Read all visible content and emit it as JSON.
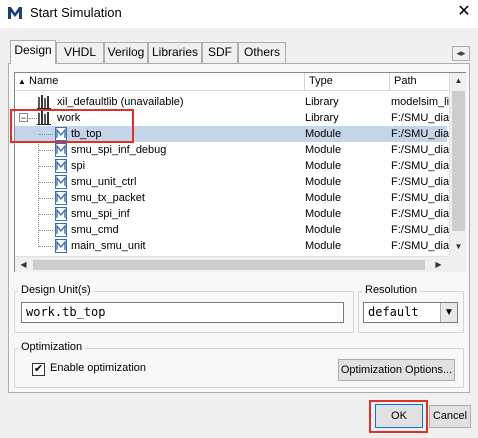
{
  "window": {
    "title": "Start Simulation",
    "close_glyph": "✕",
    "icon": "modelsim-logo-icon"
  },
  "tabs": [
    "Design",
    "VHDL",
    "Verilog",
    "Libraries",
    "SDF",
    "Others"
  ],
  "active_tab": "Design",
  "tab_scroll_glyph": "◂▸",
  "tree": {
    "columns": [
      "Name",
      "Type",
      "Path"
    ],
    "rows": [
      {
        "name": "xil_defaultlib  (unavailable)",
        "type": "Library",
        "path": "modelsim_lil",
        "kind": "library",
        "expander": "+"
      },
      {
        "name": "work",
        "type": "Library",
        "path": "F:/SMU_dia",
        "kind": "library",
        "expander": "−"
      },
      {
        "name": "tb_top",
        "type": "Module",
        "path": "F:/SMU_dia",
        "kind": "module",
        "selected": true
      },
      {
        "name": "smu_spi_inf_debug",
        "type": "Module",
        "path": "F:/SMU_dia",
        "kind": "module"
      },
      {
        "name": "spi",
        "type": "Module",
        "path": "F:/SMU_dia",
        "kind": "module"
      },
      {
        "name": "smu_unit_ctrl",
        "type": "Module",
        "path": "F:/SMU_dia",
        "kind": "module"
      },
      {
        "name": "smu_tx_packet",
        "type": "Module",
        "path": "F:/SMU_dia",
        "kind": "module"
      },
      {
        "name": "smu_spi_inf",
        "type": "Module",
        "path": "F:/SMU_dia",
        "kind": "module"
      },
      {
        "name": "smu_cmd",
        "type": "Module",
        "path": "F:/SMU_dia",
        "kind": "module"
      },
      {
        "name": "main_smu_unit",
        "type": "Module",
        "path": "F:/SMU_dia",
        "kind": "module"
      }
    ]
  },
  "design_unit": {
    "legend": "Design Unit(s)",
    "value": "work.tb_top"
  },
  "resolution": {
    "legend": "Resolution",
    "value": "default"
  },
  "optimization": {
    "legend": "Optimization",
    "enable_label": "Enable optimization",
    "enabled": true,
    "options_button": "Optimization Options..."
  },
  "buttons": {
    "ok": "OK",
    "cancel": "Cancel"
  },
  "colors": {
    "selection": "#c5d5e8",
    "annotation_red": "#e0302a",
    "module_icon": "#3b6fb5"
  }
}
